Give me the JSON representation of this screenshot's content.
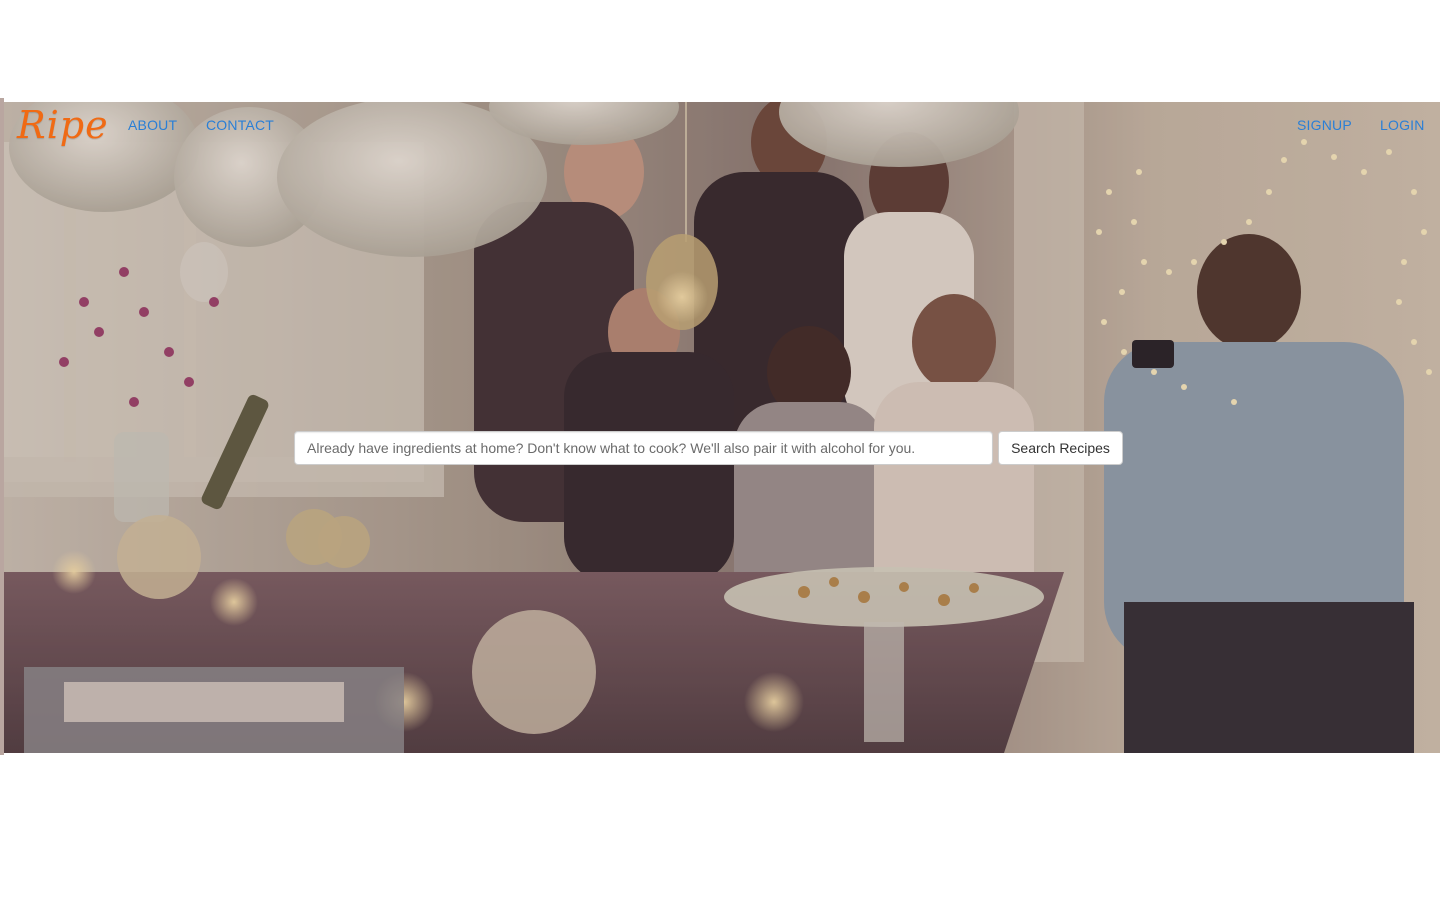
{
  "brand": {
    "logo_text": "Ripe",
    "logo_color": "#f06a14"
  },
  "nav": {
    "left": [
      {
        "label": "ABOUT"
      },
      {
        "label": "CONTACT"
      }
    ],
    "right": [
      {
        "label": "SIGNUP"
      },
      {
        "label": "LOGIN"
      }
    ],
    "link_color": "#2a7fd6"
  },
  "search": {
    "placeholder": "Already have ingredients at home? Don't know what to cook? We'll also pair it with alcohol for you.",
    "value": "",
    "button_label": "Search Recipes"
  },
  "hero": {
    "image_subject": "dinner-party-photo",
    "tint_color": "#6f5a55"
  }
}
